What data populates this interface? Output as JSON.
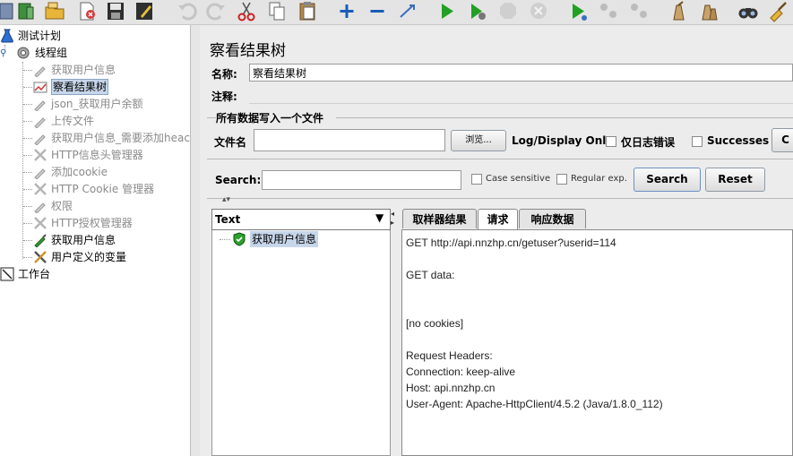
{
  "tree": {
    "root": "测试计划",
    "thread_group": "线程组",
    "items": [
      {
        "label": "获取用户信息",
        "disabled": true
      },
      {
        "label": "察看结果树",
        "disabled": false,
        "selected": true
      },
      {
        "label": "json_获取用户余额",
        "disabled": true
      },
      {
        "label": "上传文件",
        "disabled": true
      },
      {
        "label": "获取用户信息_需要添加heac",
        "disabled": true
      },
      {
        "label": "HTTP信息头管理器",
        "disabled": true
      },
      {
        "label": "添加cookie",
        "disabled": true
      },
      {
        "label": "HTTP Cookie 管理器",
        "disabled": true
      },
      {
        "label": "权限",
        "disabled": true
      },
      {
        "label": "HTTP授权管理器",
        "disabled": true
      },
      {
        "label": "获取用户信息",
        "disabled": false
      },
      {
        "label": "用户定义的变量",
        "disabled": false
      }
    ],
    "workbench": "工作台"
  },
  "panel": {
    "title": "察看结果树",
    "name_label": "名称:",
    "name_value": "察看结果树",
    "comment_label": "注释:",
    "comment_value": "",
    "file_group_title": "所有数据写入一个文件",
    "filename_label": "文件名",
    "filename_value": "",
    "browse_label": "浏览...",
    "log_display_label": "Log/Display Only:",
    "errors_only_label": "仅日志错误",
    "successes_label": "Successes",
    "configure_label": "C"
  },
  "search": {
    "label": "Search:",
    "value": "",
    "case_sensitive_label": "Case sensitive",
    "regex_label": "Regular exp.",
    "search_button": "Search",
    "reset_button": "Reset"
  },
  "results": {
    "renderer": "Text",
    "samples": [
      "获取用户信息"
    ],
    "tabs": [
      {
        "label": "取样器结果",
        "active": false
      },
      {
        "label": "请求",
        "active": true
      },
      {
        "label": "响应数据",
        "active": false
      }
    ],
    "request_lines": [
      "GET http://api.nnzhp.cn/getuser?userid=114",
      "",
      "GET data:",
      "",
      "",
      "[no cookies]",
      "",
      "Request Headers:",
      "Connection: keep-alive",
      "Host: api.nnzhp.cn",
      "User-Agent: Apache-HttpClient/4.5.2 (Java/1.8.0_112)"
    ]
  },
  "colors": {
    "accent": "#1a5cb8",
    "selection": "#c7d6ea",
    "disabled_text": "#8a8a8a",
    "success": "#2ca02c"
  }
}
